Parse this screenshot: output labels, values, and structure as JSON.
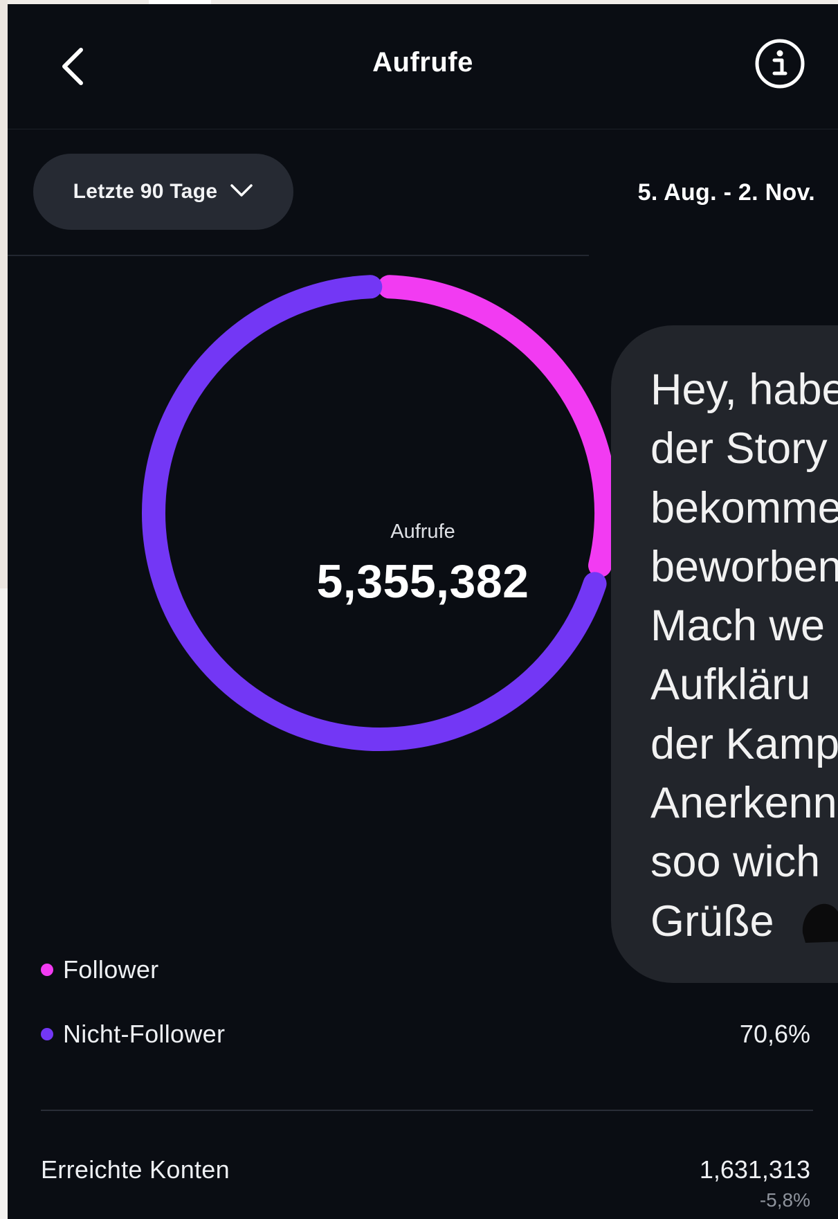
{
  "header": {
    "title": "Aufrufe"
  },
  "filter": {
    "range_label": "Letzte 90 Tage",
    "date_range": "5. Aug. - 2. Nov."
  },
  "donut": {
    "label": "Aufrufe",
    "total": "5,355,382",
    "follower_share": 0.294,
    "non_follower_share": 0.706
  },
  "legend": [
    {
      "name": "Follower",
      "color": "#f23bf2",
      "percent": ""
    },
    {
      "name": "Nicht-Follower",
      "color": "#7337f5",
      "percent": "70,6%"
    }
  ],
  "stats": {
    "reach_label": "Erreichte Konten",
    "reach_value": "1,631,313",
    "reach_change": "-5,8%"
  },
  "message": {
    "lines": [
      "Hey, habe",
      "der Story",
      "bekomme",
      "beworben",
      "Mach we",
      "Aufkläru",
      "der Kamp",
      "Anerkenn",
      "soo wich",
      "Grüße"
    ]
  },
  "icons": {
    "back": "chevron-left-icon",
    "info": "info-circle-icon",
    "dropdown": "chevron-down-icon"
  }
}
